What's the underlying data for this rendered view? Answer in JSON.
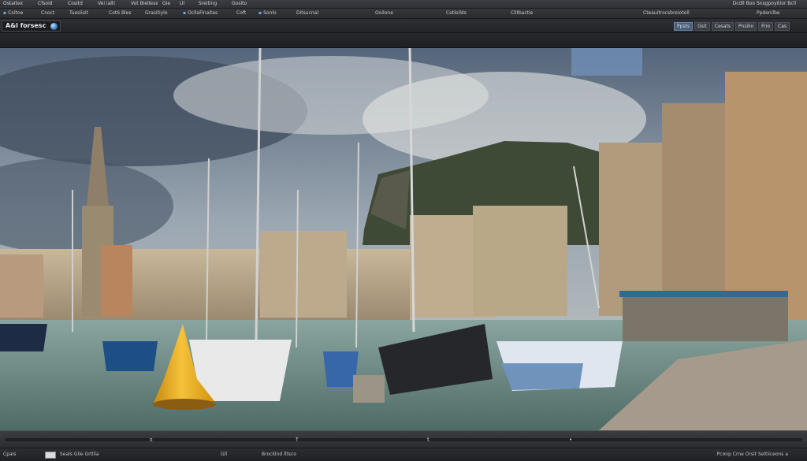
{
  "menubar": {
    "items": [
      "Ostaitex",
      "Cfsoid",
      "Cositd",
      "Vei ialti",
      "Vot Bielless",
      "Gie",
      "Ul",
      "Sreiting",
      "Gosito"
    ],
    "right": "Dcdll Boo Snsgpoyitior   Bcll"
  },
  "toolbar": {
    "items": [
      "Coltoe",
      "Cnoct",
      "Tuesiisit",
      "Cot6 Bles",
      "Grasitiyle",
      "OcllaFinaitas",
      "Coft",
      "Sonlo",
      "Ditsucnal",
      "Ooilone",
      "Cotloilds",
      "Clitbactie",
      "Cteauitrocsbreiotoll",
      "Ppdenilbe"
    ]
  },
  "app": {
    "title": "A&l forsesc",
    "globe_icon": "globe-icon",
    "view_tabs": [
      "Ppsts",
      "Gsit",
      "Cesats",
      "Pnsilio",
      "Frio",
      "Cas"
    ],
    "active_tab_index": 0
  },
  "scroll": {
    "markers": [
      "ε",
      "↑",
      "t",
      "•"
    ]
  },
  "status": {
    "left": [
      "Cpals",
      "Seals Glie Grtllia",
      "Gll",
      "Brocklnd lltsco"
    ],
    "right": "Pconp Crne Orsit Seltiiceons   a"
  },
  "colors": {
    "accent": "#7fa7d6",
    "buoy": "#f2b01e",
    "sky_top": "#5d6d80",
    "water": "#6e8c86"
  }
}
